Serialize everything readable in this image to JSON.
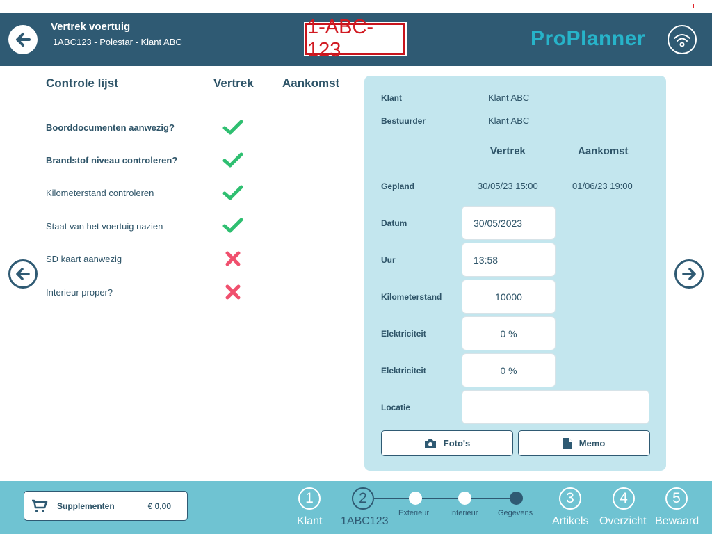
{
  "header": {
    "title": "Vertrek voertuig",
    "subtitle": "1ABC123 -  Polestar - Klant ABC",
    "plate": "1-ABC-123",
    "logo_text": "ProPlanner"
  },
  "checklist": {
    "title": "Controle lijst",
    "col_departure": "Vertrek",
    "col_arrival": "Aankomst",
    "items": [
      {
        "label": "Boorddocumenten aanwezig?",
        "status": "check"
      },
      {
        "label": "Brandstof niveau controleren?",
        "status": "check"
      },
      {
        "label": "Kilometerstand controleren",
        "status": "check"
      },
      {
        "label": "Staat van het voertuig nazien",
        "status": "check"
      },
      {
        "label": "SD kaart aanwezig",
        "status": "cross"
      },
      {
        "label": "Interieur proper?",
        "status": "cross"
      }
    ]
  },
  "panel": {
    "klant_label": "Klant",
    "klant_value": "Klant ABC",
    "bestuurder_label": "Bestuurder",
    "bestuurder_value": "Klant ABC",
    "col_departure": "Vertrek",
    "col_arrival": "Aankomst",
    "gepland_label": "Gepland",
    "gepland_departure": "30/05/23 15:00",
    "gepland_arrival": "01/06/23 19:00",
    "datum_label": "Datum",
    "datum_value": "30/05/2023",
    "uur_label": "Uur",
    "uur_value": "13:58",
    "km_label": "Kilometerstand",
    "km_value": "10000",
    "elek1_label": "Elektriciteit",
    "elek1_value": "0 %",
    "elek2_label": "Elektriciteit",
    "elek2_value": "0 %",
    "locatie_label": "Locatie",
    "locatie_value": "",
    "foto_label": "Foto's",
    "memo_label": "Memo"
  },
  "footer": {
    "supplements_label": "Supplementen",
    "supplements_value": "€ 0,00",
    "steps": [
      {
        "num": "1",
        "label": "Klant"
      },
      {
        "num": "2",
        "label": "1ABC123"
      },
      {
        "num": "3",
        "label": "Artikels"
      },
      {
        "num": "4",
        "label": "Overzicht"
      },
      {
        "num": "5",
        "label": "Bewaard"
      }
    ],
    "substeps": [
      {
        "label": "Exterieur"
      },
      {
        "label": "Interieur"
      },
      {
        "label": "Gegevens"
      }
    ]
  },
  "colors": {
    "header_bg": "#2f5a73",
    "accent": "#27b3c9",
    "panel_bg": "#c3e6ee",
    "footer_bg": "#6fc3d2",
    "check": "#2fbf71",
    "cross": "#f0506e",
    "plate_red": "#d11a22"
  },
  "icons": {
    "back": "arrow-left-circle-icon",
    "logo": "wifi-circle-icon",
    "check": "checkmark-icon",
    "cross": "cross-icon",
    "prev": "arrow-left-circle-icon",
    "next": "arrow-right-circle-icon",
    "camera": "camera-icon",
    "memo": "document-icon",
    "cart": "cart-icon"
  }
}
